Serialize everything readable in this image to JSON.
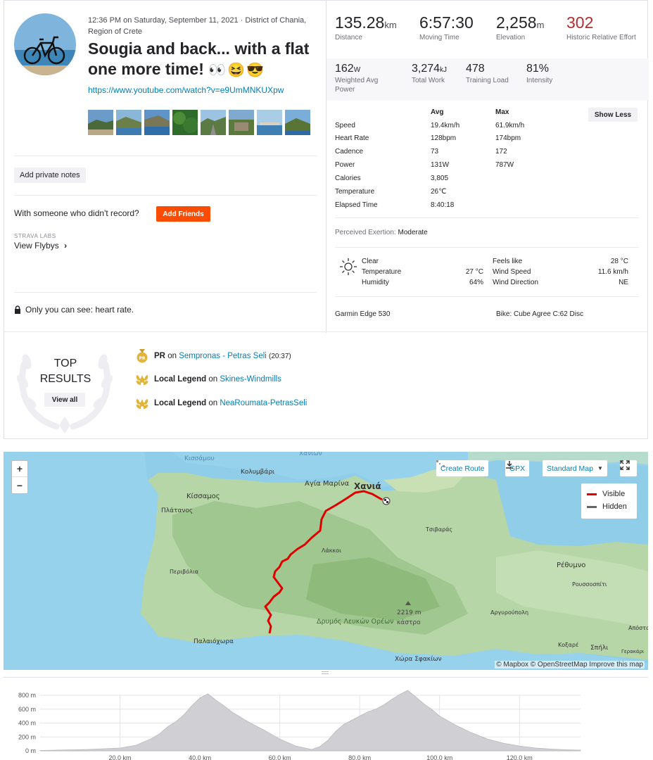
{
  "activity": {
    "datetime": "12:36 PM on Saturday, September 11, 2021 · District of Chania, Region of Crete",
    "title": "Sougia and back... with a flat one more time!",
    "title_emoji": "👀😆😎",
    "link": "https://www.youtube.com/watch?v=e9UmMNKUXpw",
    "thumb_count": 8
  },
  "left_actions": {
    "private_notes": "Add private notes",
    "with_someone": "With someone who didn't record?",
    "add_friends": "Add Friends",
    "labs_label": "STRAVA LABS",
    "view_flybys": "View Flybys",
    "privacy": "Only you can see: heart rate."
  },
  "summary": {
    "distance": {
      "value": "135.28",
      "unit": "km",
      "label": "Distance"
    },
    "moving_time": {
      "value": "6:57:30",
      "unit": "",
      "label": "Moving Time"
    },
    "elevation": {
      "value": "2,258",
      "unit": "m",
      "label": "Elevation"
    },
    "relative_effort": {
      "value": "302",
      "unit": "",
      "label": "Historic Relative Effort"
    },
    "weighted_power": {
      "value": "162",
      "unit": "W",
      "label": "Weighted Avg Power"
    },
    "total_work": {
      "value": "3,274",
      "unit": "kJ",
      "label": "Total Work"
    },
    "training_load": {
      "value": "478",
      "unit": "",
      "label": "Training Load"
    },
    "intensity": {
      "value": "81%",
      "unit": "",
      "label": "Intensity"
    }
  },
  "stats": {
    "avg_header": "Avg",
    "max_header": "Max",
    "show_less": "Show Less",
    "rows": [
      {
        "label": "Speed",
        "avg": "19.4km/h",
        "max": "61.9km/h"
      },
      {
        "label": "Heart Rate",
        "avg": "128bpm",
        "max": "174bpm"
      },
      {
        "label": "Cadence",
        "avg": "73",
        "max": "172"
      },
      {
        "label": "Power",
        "avg": "131W",
        "max": "787W"
      },
      {
        "label": "Calories",
        "avg": "3,805",
        "max": ""
      },
      {
        "label": "Temperature",
        "avg": "26℃",
        "max": ""
      },
      {
        "label": "Elapsed Time",
        "avg": "8:40:18",
        "max": ""
      }
    ],
    "perceived_label": "Perceived Exertion:",
    "perceived_value": "Moderate"
  },
  "weather": {
    "condition": "Clear",
    "temperature_label": "Temperature",
    "temperature": "27 °C",
    "humidity_label": "Humidity",
    "humidity": "64%",
    "feels_like_label": "Feels like",
    "feels_like": "28 °C",
    "wind_speed_label": "Wind Speed",
    "wind_speed": "11.6 km/h",
    "wind_dir_label": "Wind Direction",
    "wind_dir": "NE"
  },
  "gear": {
    "device": "Garmin Edge 530",
    "bike": "Bike: Cube Agree C:62 Disc"
  },
  "top_results": {
    "title_line1": "TOP",
    "title_line2": "RESULTS",
    "view_all": "View all",
    "items": [
      {
        "badge": "PR",
        "on": "on",
        "segment": "Sempronas - Petras Seli",
        "extra": "(20:37)"
      },
      {
        "badge": "Local Legend",
        "on": "on",
        "segment": "Skines-Windmills",
        "extra": ""
      },
      {
        "badge": "Local Legend",
        "on": "on",
        "segment": "NeaRoumata-PetrasSeli",
        "extra": ""
      }
    ]
  },
  "map": {
    "zoom_in": "+",
    "zoom_out": "−",
    "create_route": "Create Route",
    "gpx": "GPX",
    "map_style": "Standard Map",
    "legend_visible": "Visible",
    "legend_hidden": "Hidden",
    "attribution": "© Mapbox © OpenStreetMap Improve this map",
    "route_color": "#e00000",
    "places": {
      "kissamou_top": "Κισσάμου",
      "chanion_top": "Χανίων",
      "kolymbari": "Κολυμβάρι",
      "agia_marina": "Αγία Μαρίνα",
      "chania": "Χανιά",
      "kissamos": "Κίσσαμος",
      "platanos": "Πλάτανος",
      "tsivaras": "Τσιβαράς",
      "lakkoi": "Λάκκοι",
      "rethymno": "Ρέθυμνο",
      "perivolia": "Περιβόλια",
      "roussospiti": "Ρουσσοσπίτι",
      "peak": "2219 m",
      "kastro": "κάστρο",
      "lefka_ori": "Δρυμός Λευκών Ορέων",
      "argyroupoli": "Αργυρούπολη",
      "apostoloi": "Απόστολ",
      "paleochora": "Παλαιόχωρα",
      "kovrape": "Κοξαρέ",
      "spili": "Σπήλι",
      "gerakari": "Γερακάρι",
      "sfakion": "Χώρα Σφακίων"
    }
  },
  "elevation_chart": {
    "y_ticks": [
      "800 m",
      "600 m",
      "400 m",
      "200 m",
      "0 m"
    ],
    "x_ticks": [
      "20.0 km",
      "40.0 km",
      "60.0 km",
      "80.0 km",
      "100.0 km",
      "120.0 km"
    ]
  },
  "chart_data": {
    "type": "area",
    "title": "",
    "xlabel": "",
    "ylabel": "",
    "xlim": [
      0,
      135.28
    ],
    "ylim": [
      0,
      800
    ],
    "x": [
      0,
      4,
      8,
      12,
      16,
      20,
      24,
      28,
      30,
      32,
      34,
      36,
      38,
      40,
      42,
      44,
      46,
      48,
      52,
      56,
      60,
      64,
      68,
      70,
      72,
      74,
      76,
      78,
      80,
      82,
      84,
      86,
      88,
      90,
      92,
      94,
      96,
      98,
      100,
      104,
      108,
      112,
      116,
      120,
      124,
      128,
      132,
      135.28
    ],
    "y": [
      5,
      10,
      15,
      20,
      30,
      40,
      80,
      180,
      250,
      350,
      420,
      520,
      650,
      760,
      820,
      730,
      650,
      560,
      420,
      300,
      170,
      70,
      20,
      60,
      150,
      280,
      380,
      440,
      500,
      560,
      600,
      660,
      740,
      810,
      870,
      780,
      680,
      600,
      500,
      370,
      260,
      170,
      110,
      70,
      40,
      25,
      15,
      10
    ],
    "fill": "#cfcfd4",
    "grid": true
  }
}
